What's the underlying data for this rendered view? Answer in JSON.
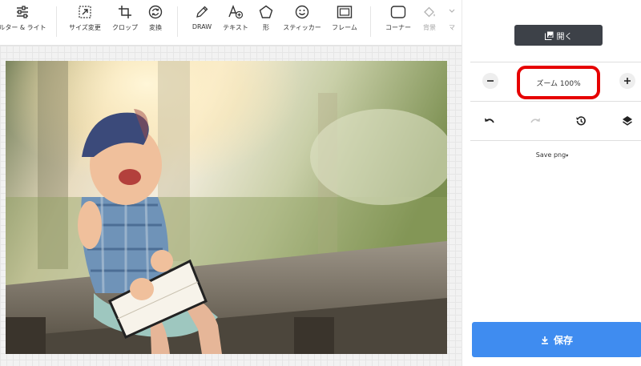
{
  "toolbar": {
    "tools": [
      {
        "label": "ルター & ライト",
        "icon": "sliders-icon"
      },
      {
        "label": "サイズ変更",
        "icon": "resize-icon"
      },
      {
        "label": "クロップ",
        "icon": "crop-icon"
      },
      {
        "label": "変換",
        "icon": "transform-icon"
      },
      {
        "label": "DRAW",
        "icon": "pencil-icon"
      },
      {
        "label": "テキスト",
        "icon": "text-icon"
      },
      {
        "label": "形",
        "icon": "shape-icon"
      },
      {
        "label": "スティッカー",
        "icon": "sticker-icon"
      },
      {
        "label": "フレーム",
        "icon": "frame-icon"
      },
      {
        "label": "コーナー",
        "icon": "corner-icon"
      },
      {
        "label": "背景",
        "icon": "fill-icon"
      },
      {
        "label": "マ",
        "icon": "overflow-icon"
      }
    ]
  },
  "panel": {
    "open_label": "開く",
    "zoom_label": "ズーム 100%",
    "save_format": "Save png",
    "save_label": "保存"
  },
  "colors": {
    "accent": "#3f8cf0",
    "dark_button": "#3d4148",
    "highlight": "#e60000"
  }
}
